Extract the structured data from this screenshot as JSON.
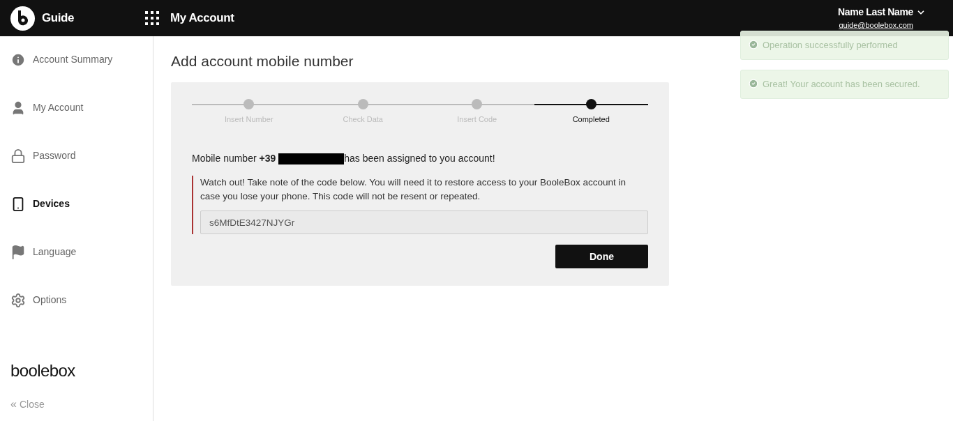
{
  "header": {
    "app_name": "Guide",
    "section": "My Account",
    "user_name": "Name Last Name",
    "user_email": "guide@boolebox.com"
  },
  "sidebar": {
    "items": [
      {
        "label": "Account Summary",
        "kind": "info",
        "selected": false
      },
      {
        "label": "My Account",
        "kind": "user",
        "selected": false
      },
      {
        "label": "Password",
        "kind": "lock",
        "selected": false
      },
      {
        "label": "Devices",
        "kind": "phone",
        "selected": true
      },
      {
        "label": "Language",
        "kind": "flag",
        "selected": false
      },
      {
        "label": "Options",
        "kind": "gears",
        "selected": false
      }
    ],
    "logo": "boolebox",
    "close": "Close",
    "close_icon": "«"
  },
  "page": {
    "title": "Add account mobile number",
    "steps": [
      {
        "label": "Insert Number",
        "selected": false
      },
      {
        "label": "Check Data",
        "selected": false
      },
      {
        "label": "Insert Code",
        "selected": false
      },
      {
        "label": "Completed",
        "selected": true
      }
    ],
    "message_before": "Mobile number **+39**",
    "message_after": "has been assigned to you account!",
    "warning": "Watch out! Take note of the code below. You will need it to restore access to your BooleBox account in case you lose your phone. This code will not be resent or repeated.",
    "code": "s6MfDtE3427NJYGr",
    "done_button": "Done"
  },
  "toasts": [
    {
      "text": "Operation successfully performed"
    },
    {
      "text": "Great! Your account has been secured."
    }
  ]
}
